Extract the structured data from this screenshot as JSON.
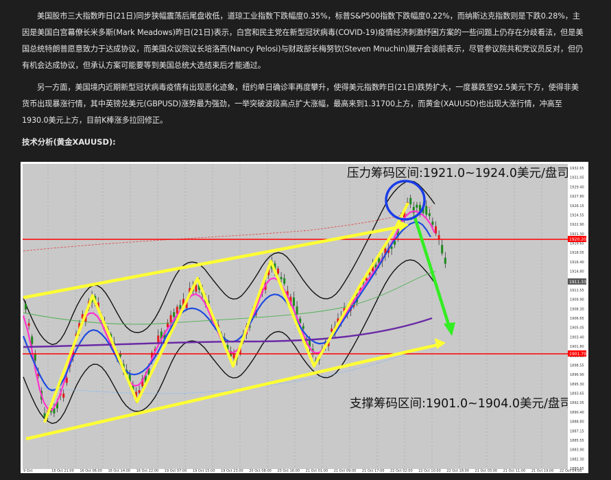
{
  "article": {
    "p1": "美国股市三大指数昨日(21日)同步狭幅震荡后尾盘收低，道琼工业指数下跌幅度0.35%，标普S&P500指数下跌幅度0.22%，而纳斯达克指数则是下跌0.28%，主因是美国白宫幕僚长米多斯(Mark Meadows)昨日(21日)表示，白宫和民主党在新型冠状病毒(COVID-19)疫情经济刺激纾困方案的一些问题上仍存在分歧看法，但是美国总统特朗普愿意致力于达成协议，而美国众议院议长培洛西(Nancy Pelosi)与财政部长梅努钦(Steven Mnuchin)展开会谈前表示，尽管参议院共和党议员反对，但仍有机会达成协议，但承认方案可能要等到美国总统大选结束后才能通过。",
    "p2": "另一方面，美国境内近期新型冠状病毒疫情有出现恶化迹象，纽约单日确诊率再度攀升，使得美元指数昨日(21日)跌势扩大，一度暴跌至92.5美元下方，使得非美货币出现暴涨行情，其中英镑兑美元(GBPUSD)涨势最为强劲，一举突破波段高点扩大涨幅，最高来到1.31700上方，而黄金(XAUUSD)也出现大涨行情，冲高至1930.0美元上方，目前K棒涨多拉回修正。",
    "heading": "技术分析(黄金XAUUSD):"
  },
  "chart": {
    "resistance_label": "压力筹码区间:1921.0~1924.0美元/盘司",
    "support_label": "支撑筹码区间:1901.0~1904.0美元/盘司",
    "price_ticks": [
      "1932.65",
      "1931.05",
      "1929.40",
      "1927.80",
      "1926.15",
      "1924.55",
      "1922.90",
      "1921.30",
      "1919.65",
      "1918.05",
      "1916.40",
      "1914.80",
      "1913.15",
      "1911.55",
      "1909.90",
      "1908.30",
      "1906.65",
      "1905.05",
      "1903.40",
      "1901.80",
      "1900.15",
      "1898.55",
      "1896.90",
      "1895.30",
      "1893.65",
      "1892.05",
      "1890.40",
      "1888.80",
      "1887.15",
      "1885.55",
      "1883.90",
      "1882.30",
      "1880.65"
    ],
    "price_marker_upper": "1920.20",
    "price_marker_mid": "1911.33",
    "price_marker_lower": "1901.79",
    "time_ticks": [
      "9 Oct",
      "16 Oct 21:00",
      "16 Oct 06:00",
      "16 Oct 14:00",
      "16 Oct 22:00",
      "19 Oct 07:00",
      "19 Oct 15:00",
      "19 Oct 23:00",
      "20 Oct 08:00",
      "20 Oct 16:00",
      "21 Oct 01:00",
      "21 Oct 09:00",
      "21 Oct 17:00",
      "22 Oct 02:00",
      "22 Oct 10:00",
      "22 Oct 18:00",
      "21 Oct 03:00",
      "21 Oct 11:00",
      "21 Oct 19:00",
      "22 Oct 04:00"
    ],
    "colors": {
      "resistance_line": "#ff0000",
      "support_line": "#ff0000",
      "wave_arrows": "#ffff33",
      "channel_arrows": "#ffff33",
      "forecast_arrow": "#33ee22",
      "circle": "#1a3ee8",
      "bollinger": "#111111",
      "ma_fast": "#ff33cc",
      "ma_mid": "#1d4be0",
      "ma_slow": "#6a2aa6",
      "candle_up": "#e11d1d",
      "candle_down": "#1d8a1d"
    }
  }
}
